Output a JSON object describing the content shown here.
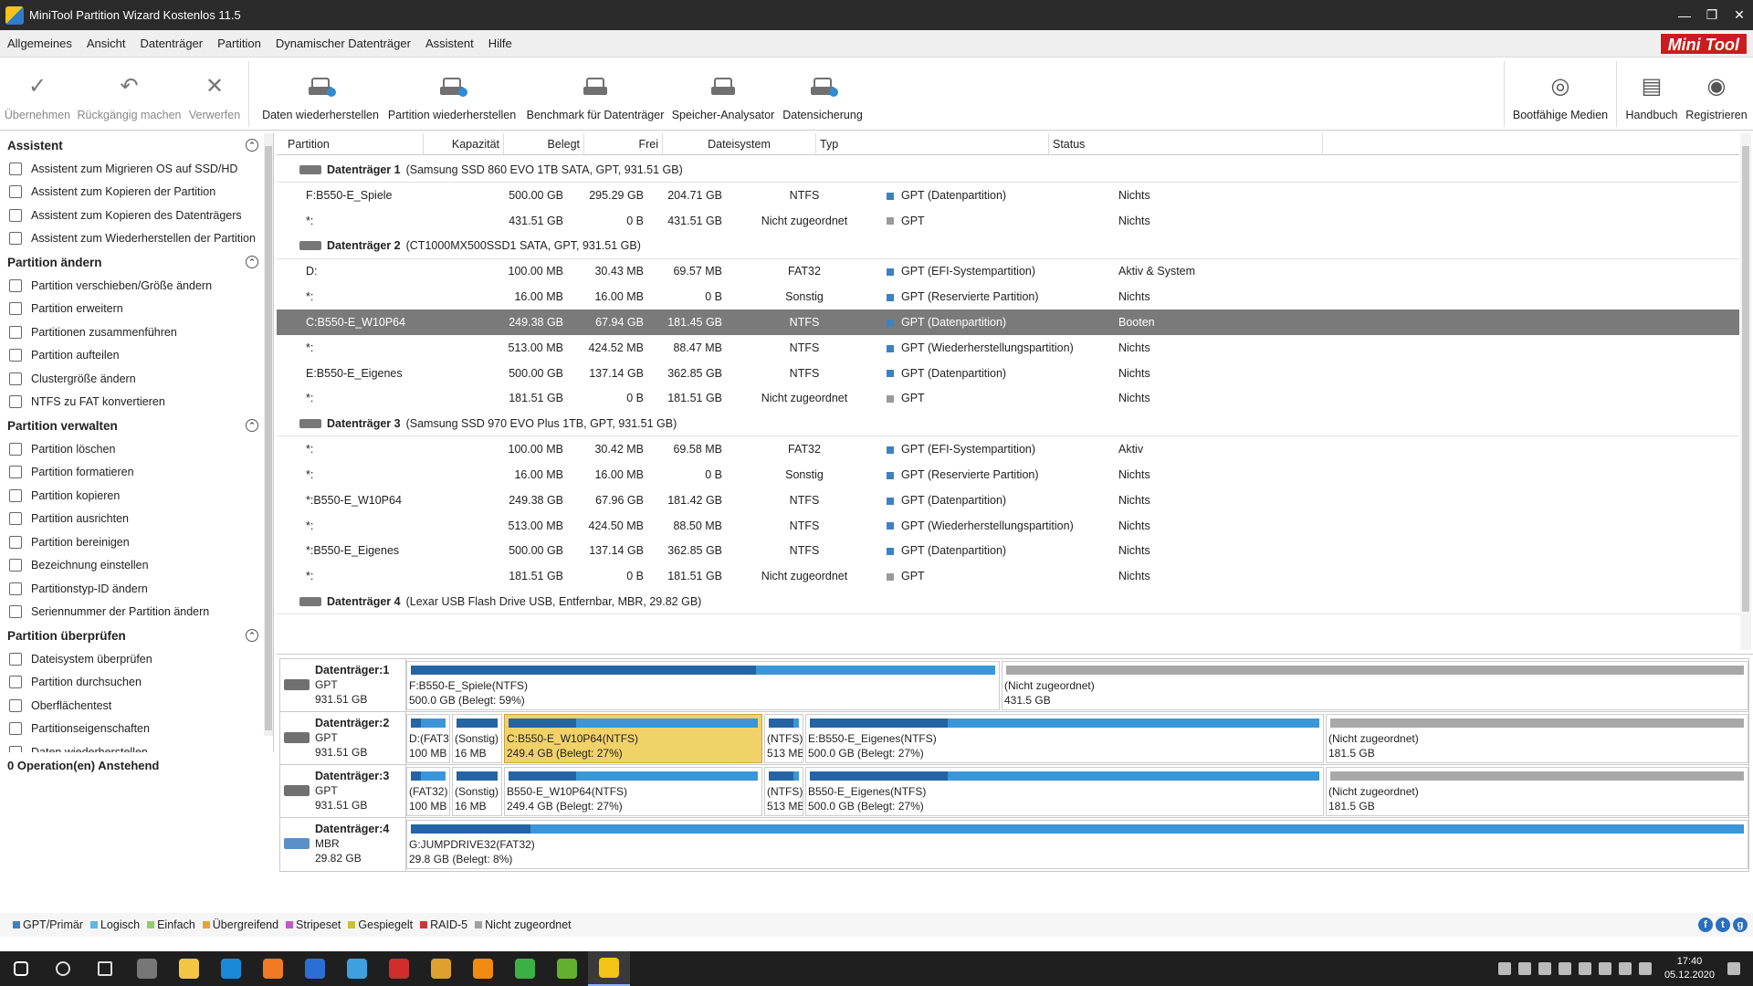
{
  "window": {
    "title": "MiniTool Partition Wizard Kostenlos 11.5",
    "minimize": "—",
    "restore": "❐",
    "close": "✕"
  },
  "menu": [
    "Allgemeines",
    "Ansicht",
    "Datenträger",
    "Partition",
    "Dynamischer Datenträger",
    "Assistent",
    "Hilfe"
  ],
  "logo": "Mini Tool",
  "toolbar": {
    "apply": "Übernehmen",
    "undo": "Rückgängig machen",
    "discard": "Verwerfen",
    "data_recovery": "Daten wiederherstellen",
    "partition_recovery": "Partition wiederherstellen",
    "benchmark": "Benchmark für Datenträger",
    "space_analyzer": "Speicher-Analysator",
    "backup": "Datensicherung",
    "bootable_media": "Bootfähige Medien",
    "manual": "Handbuch",
    "register": "Registrieren"
  },
  "sidebar": {
    "sections": [
      {
        "title": "Assistent",
        "items": [
          "Assistent zum Migrieren OS auf SSD/HD",
          "Assistent zum Kopieren der Partition",
          "Assistent zum Kopieren des Datenträgers",
          "Assistent zum Wiederherstellen der Partition"
        ]
      },
      {
        "title": "Partition ändern",
        "items": [
          "Partition verschieben/Größe ändern",
          "Partition erweitern",
          "Partitionen zusammenführen",
          "Partition aufteilen",
          "Clustergröße ändern",
          "NTFS zu FAT konvertieren"
        ]
      },
      {
        "title": "Partition verwalten",
        "items": [
          "Partition löschen",
          "Partition formatieren",
          "Partition kopieren",
          "Partition ausrichten",
          "Partition bereinigen",
          "Bezeichnung einstellen",
          "Partitionstyp-ID ändern",
          "Seriennummer der Partition ändern"
        ]
      },
      {
        "title": "Partition überprüfen",
        "items": [
          "Dateisystem überprüfen",
          "Partition durchsuchen",
          "Oberflächentest",
          "Partitionseigenschaften",
          "Daten wiederherstellen"
        ]
      }
    ],
    "pending": "0 Operation(en) Anstehend"
  },
  "table": {
    "columns": [
      "Partition",
      "Kapazität",
      "Belegt",
      "Frei",
      "Dateisystem",
      "Typ",
      "Status"
    ],
    "disks": [
      {
        "name": "Datenträger 1",
        "desc": "(Samsung SSD 860 EVO 1TB SATA, GPT, 931.51 GB)",
        "rows": [
          {
            "p": "F:B550-E_Spiele",
            "cap": "500.00 GB",
            "used": "295.29 GB",
            "free": "204.71 GB",
            "fs": "NTFS",
            "type": "GPT (Datenpartition)",
            "status": "Nichts",
            "gray": false,
            "sel": false
          },
          {
            "p": "*:",
            "cap": "431.51 GB",
            "used": "0 B",
            "free": "431.51 GB",
            "fs": "Nicht zugeordnet",
            "type": "GPT",
            "status": "Nichts",
            "gray": true,
            "sel": false
          }
        ]
      },
      {
        "name": "Datenträger 2",
        "desc": "(CT1000MX500SSD1 SATA, GPT, 931.51 GB)",
        "rows": [
          {
            "p": "D:",
            "cap": "100.00 MB",
            "used": "30.43 MB",
            "free": "69.57 MB",
            "fs": "FAT32",
            "type": "GPT (EFI-Systempartition)",
            "status": "Aktiv & System",
            "gray": false,
            "sel": false
          },
          {
            "p": "*:",
            "cap": "16.00 MB",
            "used": "16.00 MB",
            "free": "0 B",
            "fs": "Sonstig",
            "type": "GPT (Reservierte Partition)",
            "status": "Nichts",
            "gray": false,
            "sel": false
          },
          {
            "p": "C:B550-E_W10P64",
            "cap": "249.38 GB",
            "used": "67.94 GB",
            "free": "181.45 GB",
            "fs": "NTFS",
            "type": "GPT (Datenpartition)",
            "status": "Booten",
            "gray": false,
            "sel": true
          },
          {
            "p": "*:",
            "cap": "513.00 MB",
            "used": "424.52 MB",
            "free": "88.47 MB",
            "fs": "NTFS",
            "type": "GPT (Wiederherstellungspartition)",
            "status": "Nichts",
            "gray": false,
            "sel": false
          },
          {
            "p": "E:B550-E_Eigenes",
            "cap": "500.00 GB",
            "used": "137.14 GB",
            "free": "362.85 GB",
            "fs": "NTFS",
            "type": "GPT (Datenpartition)",
            "status": "Nichts",
            "gray": false,
            "sel": false
          },
          {
            "p": "*:",
            "cap": "181.51 GB",
            "used": "0 B",
            "free": "181.51 GB",
            "fs": "Nicht zugeordnet",
            "type": "GPT",
            "status": "Nichts",
            "gray": true,
            "sel": false
          }
        ]
      },
      {
        "name": "Datenträger 3",
        "desc": "(Samsung SSD 970 EVO Plus 1TB, GPT, 931.51 GB)",
        "rows": [
          {
            "p": "*:",
            "cap": "100.00 MB",
            "used": "30.42 MB",
            "free": "69.58 MB",
            "fs": "FAT32",
            "type": "GPT (EFI-Systempartition)",
            "status": "Aktiv",
            "gray": false,
            "sel": false
          },
          {
            "p": "*:",
            "cap": "16.00 MB",
            "used": "16.00 MB",
            "free": "0 B",
            "fs": "Sonstig",
            "type": "GPT (Reservierte Partition)",
            "status": "Nichts",
            "gray": false,
            "sel": false
          },
          {
            "p": "*:B550-E_W10P64",
            "cap": "249.38 GB",
            "used": "67.96 GB",
            "free": "181.42 GB",
            "fs": "NTFS",
            "type": "GPT (Datenpartition)",
            "status": "Nichts",
            "gray": false,
            "sel": false
          },
          {
            "p": "*:",
            "cap": "513.00 MB",
            "used": "424.50 MB",
            "free": "88.50 MB",
            "fs": "NTFS",
            "type": "GPT (Wiederherstellungspartition)",
            "status": "Nichts",
            "gray": false,
            "sel": false
          },
          {
            "p": "*:B550-E_Eigenes",
            "cap": "500.00 GB",
            "used": "137.14 GB",
            "free": "362.85 GB",
            "fs": "NTFS",
            "type": "GPT (Datenpartition)",
            "status": "Nichts",
            "gray": false,
            "sel": false
          },
          {
            "p": "*:",
            "cap": "181.51 GB",
            "used": "0 B",
            "free": "181.51 GB",
            "fs": "Nicht zugeordnet",
            "type": "GPT",
            "status": "Nichts",
            "gray": true,
            "sel": false
          }
        ]
      },
      {
        "name": "Datenträger 4",
        "desc": "(Lexar USB Flash Drive USB, Entfernbar, MBR, 29.82 GB)",
        "rows": []
      }
    ]
  },
  "diskmap": [
    {
      "name": "Datenträger:1",
      "style": "GPT",
      "size": "931.51 GB",
      "usb": false,
      "parts": [
        {
          "l1": "F:B550-E_Spiele(NTFS)",
          "l2": "500.0 GB (Belegt: 59%)",
          "used": 0.59,
          "un": false,
          "hl": false
        },
        {
          "l1": "(Nicht zugeordnet)",
          "l2": "431.5 GB",
          "used": 0,
          "un": true,
          "hl": false
        }
      ]
    },
    {
      "name": "Datenträger:2",
      "style": "GPT",
      "size": "931.51 GB",
      "usb": false,
      "parts": [
        {
          "l1": "D:(FAT3:",
          "l2": "100 MB (",
          "used": 0.3,
          "un": false,
          "hl": false
        },
        {
          "l1": "(Sonstig)",
          "l2": "16 MB",
          "used": 1,
          "un": false,
          "hl": false
        },
        {
          "l1": "C:B550-E_W10P64(NTFS)",
          "l2": "249.4 GB (Belegt: 27%)",
          "used": 0.27,
          "un": false,
          "hl": true
        },
        {
          "l1": "(NTFS)",
          "l2": "513 MB (",
          "used": 0.83,
          "un": false,
          "hl": false
        },
        {
          "l1": "E:B550-E_Eigenes(NTFS)",
          "l2": "500.0 GB (Belegt: 27%)",
          "used": 0.27,
          "un": false,
          "hl": false
        },
        {
          "l1": "(Nicht zugeordnet)",
          "l2": "181.5 GB",
          "used": 0,
          "un": true,
          "hl": false
        }
      ]
    },
    {
      "name": "Datenträger:3",
      "style": "GPT",
      "size": "931.51 GB",
      "usb": false,
      "parts": [
        {
          "l1": "(FAT32)",
          "l2": "100 MB (",
          "used": 0.3,
          "un": false,
          "hl": false
        },
        {
          "l1": "(Sonstig)",
          "l2": "16 MB",
          "used": 1,
          "un": false,
          "hl": false
        },
        {
          "l1": "B550-E_W10P64(NTFS)",
          "l2": "249.4 GB (Belegt: 27%)",
          "used": 0.27,
          "un": false,
          "hl": false
        },
        {
          "l1": "(NTFS)",
          "l2": "513 MB (",
          "used": 0.83,
          "un": false,
          "hl": false
        },
        {
          "l1": "B550-E_Eigenes(NTFS)",
          "l2": "500.0 GB (Belegt: 27%)",
          "used": 0.27,
          "un": false,
          "hl": false
        },
        {
          "l1": "(Nicht zugeordnet)",
          "l2": "181.5 GB",
          "used": 0,
          "un": true,
          "hl": false
        }
      ]
    },
    {
      "name": "Datenträger:4",
      "style": "MBR",
      "size": "29.82 GB",
      "usb": true,
      "parts": [
        {
          "l1": "G:JUMPDRIVE32(FAT32)",
          "l2": "29.8 GB (Belegt: 8%)",
          "used": 0.09,
          "un": false,
          "hl": false
        }
      ]
    }
  ],
  "legend": [
    {
      "label": "GPT/Primär",
      "color": "#3a82c4"
    },
    {
      "label": "Logisch",
      "color": "#5fb6e0"
    },
    {
      "label": "Einfach",
      "color": "#8fcf6a"
    },
    {
      "label": "Übergreifend",
      "color": "#e8a23a"
    },
    {
      "label": "Stripeset",
      "color": "#c05ac9"
    },
    {
      "label": "Gespiegelt",
      "color": "#c8c036"
    },
    {
      "label": "RAID-5",
      "color": "#c83a3a"
    },
    {
      "label": "Nicht zugeordnet",
      "color": "#a0a0a0"
    }
  ],
  "social": [
    "f",
    "t",
    "g"
  ],
  "taskbar": {
    "apps": [
      "start",
      "search",
      "task-view",
      "calculator",
      "file-explorer",
      "edge",
      "firefox",
      "app-blue",
      "app-circle",
      "acrobat",
      "crown-app",
      "vlc",
      "app-multi",
      "app-green",
      "minitool"
    ],
    "time": "17:40",
    "date": "05.12.2020"
  }
}
